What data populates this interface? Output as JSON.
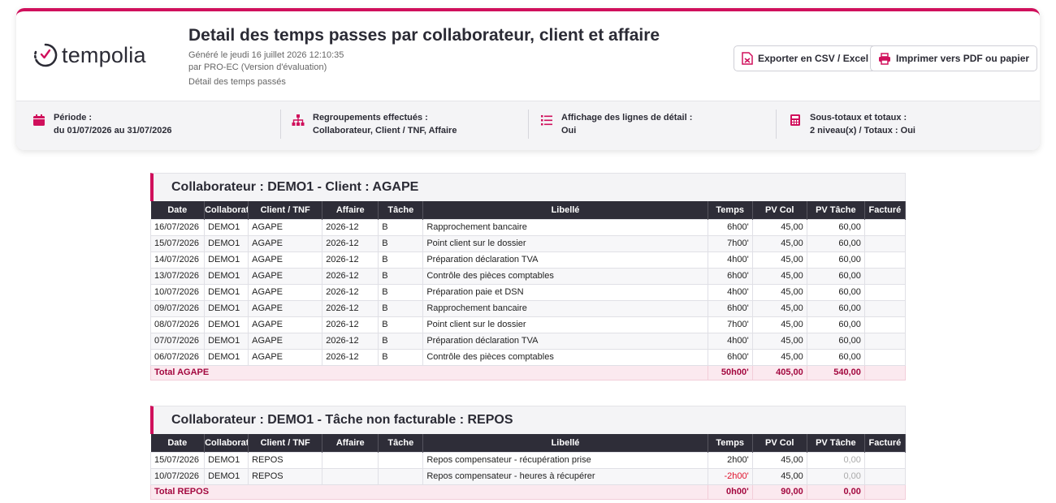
{
  "header": {
    "brand": "tempolia",
    "title": "Detail des temps passes par collaborateur, client et affaire",
    "generated": "Généré le jeudi 16 juillet 2026 12:10:35",
    "by": "par PRO-EC (Version d'évaluation)",
    "subtitle": "Détail des temps passés",
    "export_label": "Exporter en CSV / Excel",
    "print_label": "Imprimer vers PDF ou papier"
  },
  "filters": {
    "period_label": "Période :",
    "period_value": "du 01/07/2026 au 31/07/2026",
    "grouping_label": "Regroupements effectués :",
    "grouping_value": "Collaborateur, Client / TNF, Affaire",
    "detail_label": "Affichage des lignes de détail :",
    "detail_value": "Oui",
    "totals_label": "Sous-totaux et totaux :",
    "totals_value": "2 niveau(x) / Totaux : Oui"
  },
  "columns": [
    "Date",
    "Collaborateur",
    "Client / TNF",
    "Affaire",
    "Tâche",
    "Libellé",
    "Temps",
    "PV Col",
    "PV Tâche",
    "Facturé"
  ],
  "sections": [
    {
      "title": "Collaborateur : DEMO1 - Client : AGAPE",
      "rows": [
        [
          "16/07/2026",
          "DEMO1",
          "AGAPE",
          "2026-12",
          "B",
          "Rapprochement bancaire",
          "6h00'",
          "45,00",
          "60,00",
          ""
        ],
        [
          "15/07/2026",
          "DEMO1",
          "AGAPE",
          "2026-12",
          "B",
          "Point client sur le dossier",
          "7h00'",
          "45,00",
          "60,00",
          ""
        ],
        [
          "14/07/2026",
          "DEMO1",
          "AGAPE",
          "2026-12",
          "B",
          "Préparation déclaration TVA",
          "4h00'",
          "45,00",
          "60,00",
          ""
        ],
        [
          "13/07/2026",
          "DEMO1",
          "AGAPE",
          "2026-12",
          "B",
          "Contrôle des pièces comptables",
          "6h00'",
          "45,00",
          "60,00",
          ""
        ],
        [
          "10/07/2026",
          "DEMO1",
          "AGAPE",
          "2026-12",
          "B",
          "Préparation paie et DSN",
          "4h00'",
          "45,00",
          "60,00",
          ""
        ],
        [
          "09/07/2026",
          "DEMO1",
          "AGAPE",
          "2026-12",
          "B",
          "Rapprochement bancaire",
          "6h00'",
          "45,00",
          "60,00",
          ""
        ],
        [
          "08/07/2026",
          "DEMO1",
          "AGAPE",
          "2026-12",
          "B",
          "Point client sur le dossier",
          "7h00'",
          "45,00",
          "60,00",
          ""
        ],
        [
          "07/07/2026",
          "DEMO1",
          "AGAPE",
          "2026-12",
          "B",
          "Préparation déclaration TVA",
          "4h00'",
          "45,00",
          "60,00",
          ""
        ],
        [
          "06/07/2026",
          "DEMO1",
          "AGAPE",
          "2026-12",
          "B",
          "Contrôle des pièces comptables",
          "6h00'",
          "45,00",
          "60,00",
          ""
        ]
      ],
      "total": {
        "label": "Total AGAPE",
        "temps": "50h00'",
        "pv_col": "405,00",
        "pv_tache": "540,00"
      }
    },
    {
      "title": "Collaborateur : DEMO1 - Tâche non facturable : REPOS",
      "rows": [
        [
          "15/07/2026",
          "DEMO1",
          "REPOS",
          "",
          "",
          "Repos compensateur - récupération prise",
          "2h00'",
          "45,00",
          "0,00",
          ""
        ],
        [
          "10/07/2026",
          "DEMO1",
          "REPOS",
          "",
          "",
          "Repos compensateur - heures à récupérer",
          "-2h00'",
          "45,00",
          "0,00",
          ""
        ]
      ],
      "total": {
        "label": "Total REPOS",
        "temps": "0h00'",
        "pv_col": "90,00",
        "pv_tache": "0,00"
      }
    }
  ],
  "colors": {
    "accent": "#d0105c",
    "header_bg": "#2e2d38",
    "total_text": "#a3083f",
    "negative": "#e0102a"
  }
}
